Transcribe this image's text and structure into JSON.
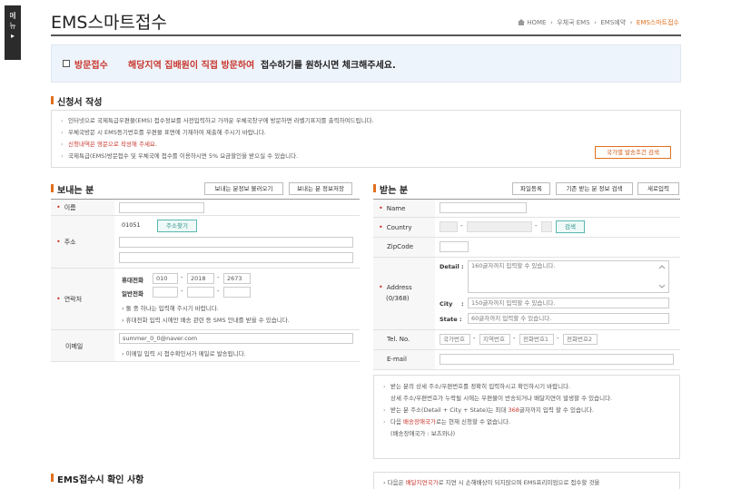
{
  "side_tab": {
    "line1": "메",
    "line2": "뉴",
    "arrow": "▸"
  },
  "page_title": "EMS스마트접수",
  "breadcrumb": {
    "home": "HOME",
    "sep": "›",
    "item1": "우체국 EMS",
    "item2": "EMS예약",
    "current": "EMS스마트접수"
  },
  "visit": {
    "label": "방문접수",
    "highlight": "해당지역 집배원이 직접 방문하여",
    "rest": "접수하기를 원하시면 체크해주세요.",
    "checked": false
  },
  "application": {
    "section_title": "신청서 작성",
    "notices": [
      {
        "text": "인터넷으로 국제특급우편물(EMS) 접수정보를 사전입력하고 가까운 우체국창구에 방문하면 라벨기표지를 출력하여드립니다.",
        "red": false
      },
      {
        "text": "우체국방문 시 EMS등기번호를 우편물 표면에 기재하여 제출해 주시기 바랍니다.",
        "red": false
      },
      {
        "text": "신청내역은 영문으로 작성해 주세요.",
        "red": true
      },
      {
        "text": "국제특급(EMS)방문접수 및 우체국에 접수를 이용하시면 5% 요금할인을 받으실 수 있습니다.",
        "red": false
      }
    ],
    "country_condition_button": "국가별 발송조건 검색"
  },
  "sender": {
    "section_title": "보내는 분",
    "load_button": "보내는 분정보 불러오기",
    "save_button": "보내는 분 정보저장",
    "name_label": "이름",
    "name_value": "",
    "address_label": "주소",
    "zipcode": "01051",
    "zip_search_button": "주소찾기",
    "address1": "",
    "address2": "",
    "contact_label": "연락처",
    "mobile_label": "휴대전화",
    "mobile": [
      "010",
      "2018",
      "2673"
    ],
    "phone_label": "일반전화",
    "phone": [
      "",
      "",
      ""
    ],
    "contact_note1": "둘 중 하나는 입력해 주시기 바랍니다.",
    "contact_note2": "휴대전화 입력 시에만 배송 관련 등 SMS 안내를 받을 수 있습니다.",
    "email_label": "이메일",
    "email": "summer_0_0@naver.com",
    "email_note": "이메일 입력 시 접수확인서가 메일로 발송됩니다."
  },
  "receiver": {
    "section_title": "받는 분",
    "file_button": "파일등록",
    "search_button": "기존 받는 분 정보 검색",
    "new_button": "새로입력",
    "name_label": "Name",
    "country_label": "Country",
    "country_search_button": "검색",
    "zipcode_label": "ZipCode",
    "address_label": "Address",
    "address_count": "(0/368)",
    "detail_label": "Detail :",
    "detail_placeholder": "160글자까지 입력할 수 있습니다.",
    "city_label": "City",
    "city_colon": ":",
    "city_placeholder": "150글자까지 입력할 수 있습니다.",
    "state_label": "State :",
    "state_placeholder": "60글자까지 입력할 수 있습니다.",
    "tel_label": "Tel. No.",
    "tel_parts": [
      "국가번호",
      "지역번호",
      "전화번호1",
      "전화번호2"
    ],
    "email_label": "E-mail"
  },
  "receiver_notice": {
    "line1": "받는 분의 상세 주소/우편번호를 정확히 입력하시고 확인하시기 바랍니다.",
    "line2": "상세 주소/우편번호가 누락될 시에는 우편물이 반송되거나 배달지연이 발생할 수 있습니다.",
    "line3_pre": "받는 분 주소(Detail + City + State)는 최대",
    "line3_num": "368",
    "line3_post": "글자까지 입력 할 수 있습니다.",
    "line4_pre": "다음",
    "line4_red": "배송장애국가",
    "line4_post": "로는 현재 신청할 수 없습니다.",
    "line5": "(배송장애국가 : 보츠와나)"
  },
  "confirm": {
    "section_title": "EMS접수시 확인 사항",
    "line_pre": "다음은",
    "line_red": "배달지연국가",
    "line_post": "로 지연 시 손해배상이 되지않으며 EMS프리미엄으로 접수할 것을"
  }
}
